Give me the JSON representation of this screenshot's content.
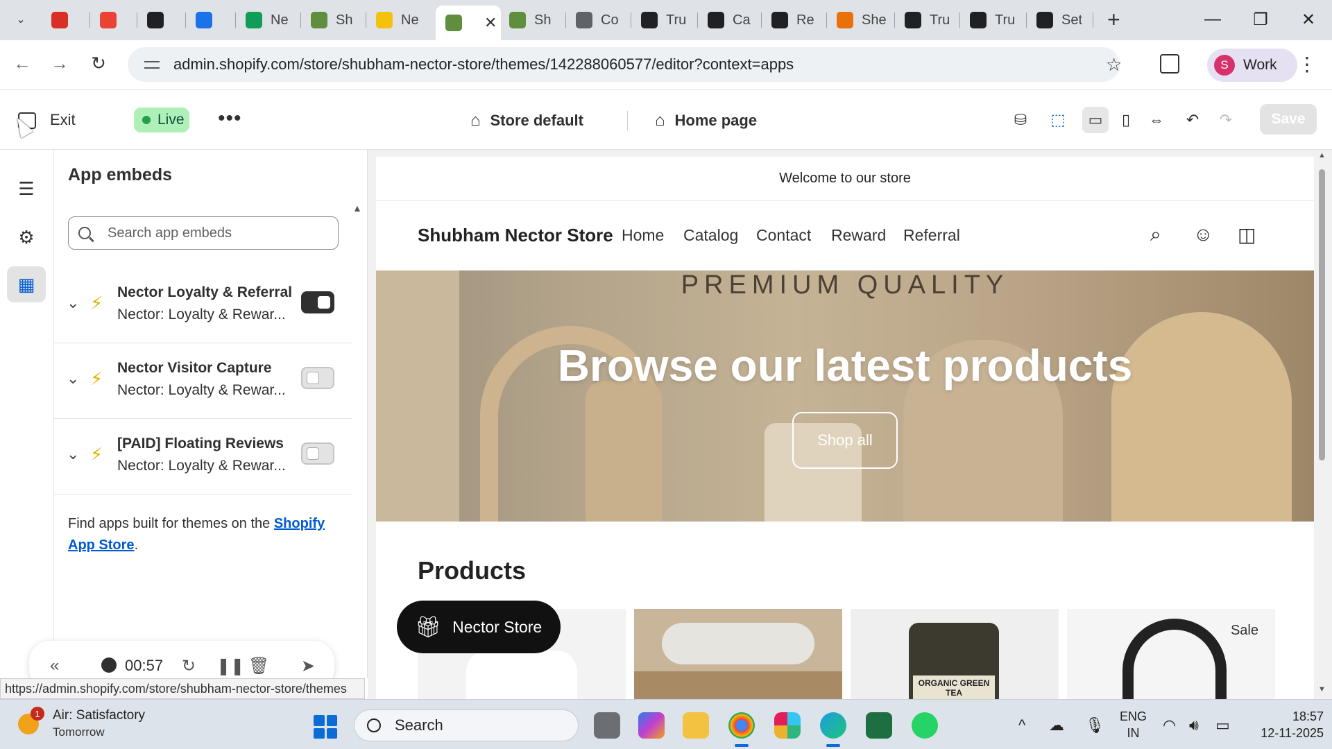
{
  "browser": {
    "tabs": [
      {
        "label": "",
        "color": "#d93025"
      },
      {
        "label": "",
        "color": "#ea4335"
      },
      {
        "label": "",
        "color": "#202124"
      },
      {
        "label": "",
        "color": "#1a73e8"
      },
      {
        "label": "Ne",
        "color": "#0f9d58"
      },
      {
        "label": "Sh",
        "color": "#5e8e3e"
      },
      {
        "label": "Ne",
        "color": "#f4c20d"
      },
      {
        "label": "",
        "color": "#5e8e3e"
      },
      {
        "label": "Sh",
        "color": "#5e8e3e"
      },
      {
        "label": "Co",
        "color": "#5f6368"
      },
      {
        "label": "Tru",
        "color": "#202124"
      },
      {
        "label": "Ca",
        "color": "#202124"
      },
      {
        "label": "Re",
        "color": "#202124"
      },
      {
        "label": "She",
        "color": "#e8710a"
      },
      {
        "label": "Tru",
        "color": "#202124"
      },
      {
        "label": "Tru",
        "color": "#202124"
      },
      {
        "label": "Set",
        "color": "#202124"
      }
    ],
    "url": "admin.shopify.com/store/shubham-nector-store/themes/142288060577/editor?context=apps",
    "profile_initial": "S",
    "profile_label": "Work",
    "status_url": "https://admin.shopify.com/store/shubham-nector-store/themes"
  },
  "editor": {
    "exit_label": "Exit",
    "live_label": "Live",
    "store_context": "Store default",
    "page_context": "Home page",
    "save_label": "Save"
  },
  "panel": {
    "title": "App embeds",
    "search_placeholder": "Search app embeds",
    "embeds": [
      {
        "name": "Nector Loyalty & Referral",
        "sub": "Nector: Loyalty & Rewar...",
        "enabled": true
      },
      {
        "name": "Nector Visitor Capture",
        "sub": "Nector: Loyalty & Rewar...",
        "enabled": false
      },
      {
        "name": "[PAID] Floating Reviews",
        "sub": "Nector: Loyalty & Rewar...",
        "enabled": false
      }
    ],
    "find_apps_prefix": "Find apps built for themes on the ",
    "find_apps_link": "Shopify App Store",
    "find_apps_suffix": "."
  },
  "recorder": {
    "time": "00:57"
  },
  "preview": {
    "announcement": "Welcome to our store",
    "store_name": "Shubham Nector Store",
    "nav": [
      "Home",
      "Catalog",
      "Contact",
      "Reward",
      "Referral"
    ],
    "hero_kicker": "PREMIUM QUALITY",
    "hero_headline": "Browse our latest products",
    "hero_cta": "Shop all",
    "products_heading": "Products",
    "sale_badge": "Sale",
    "widget_label": "Nector Store",
    "card_text": "ORGANIC GREEN TEA"
  },
  "taskbar": {
    "weather_title": "Air: Satisfactory",
    "weather_sub": "Tomorrow",
    "weather_badge": "1",
    "search_label": "Search",
    "lang_1": "ENG",
    "lang_2": "IN",
    "time": "18:57",
    "date": "12-11-2025"
  }
}
